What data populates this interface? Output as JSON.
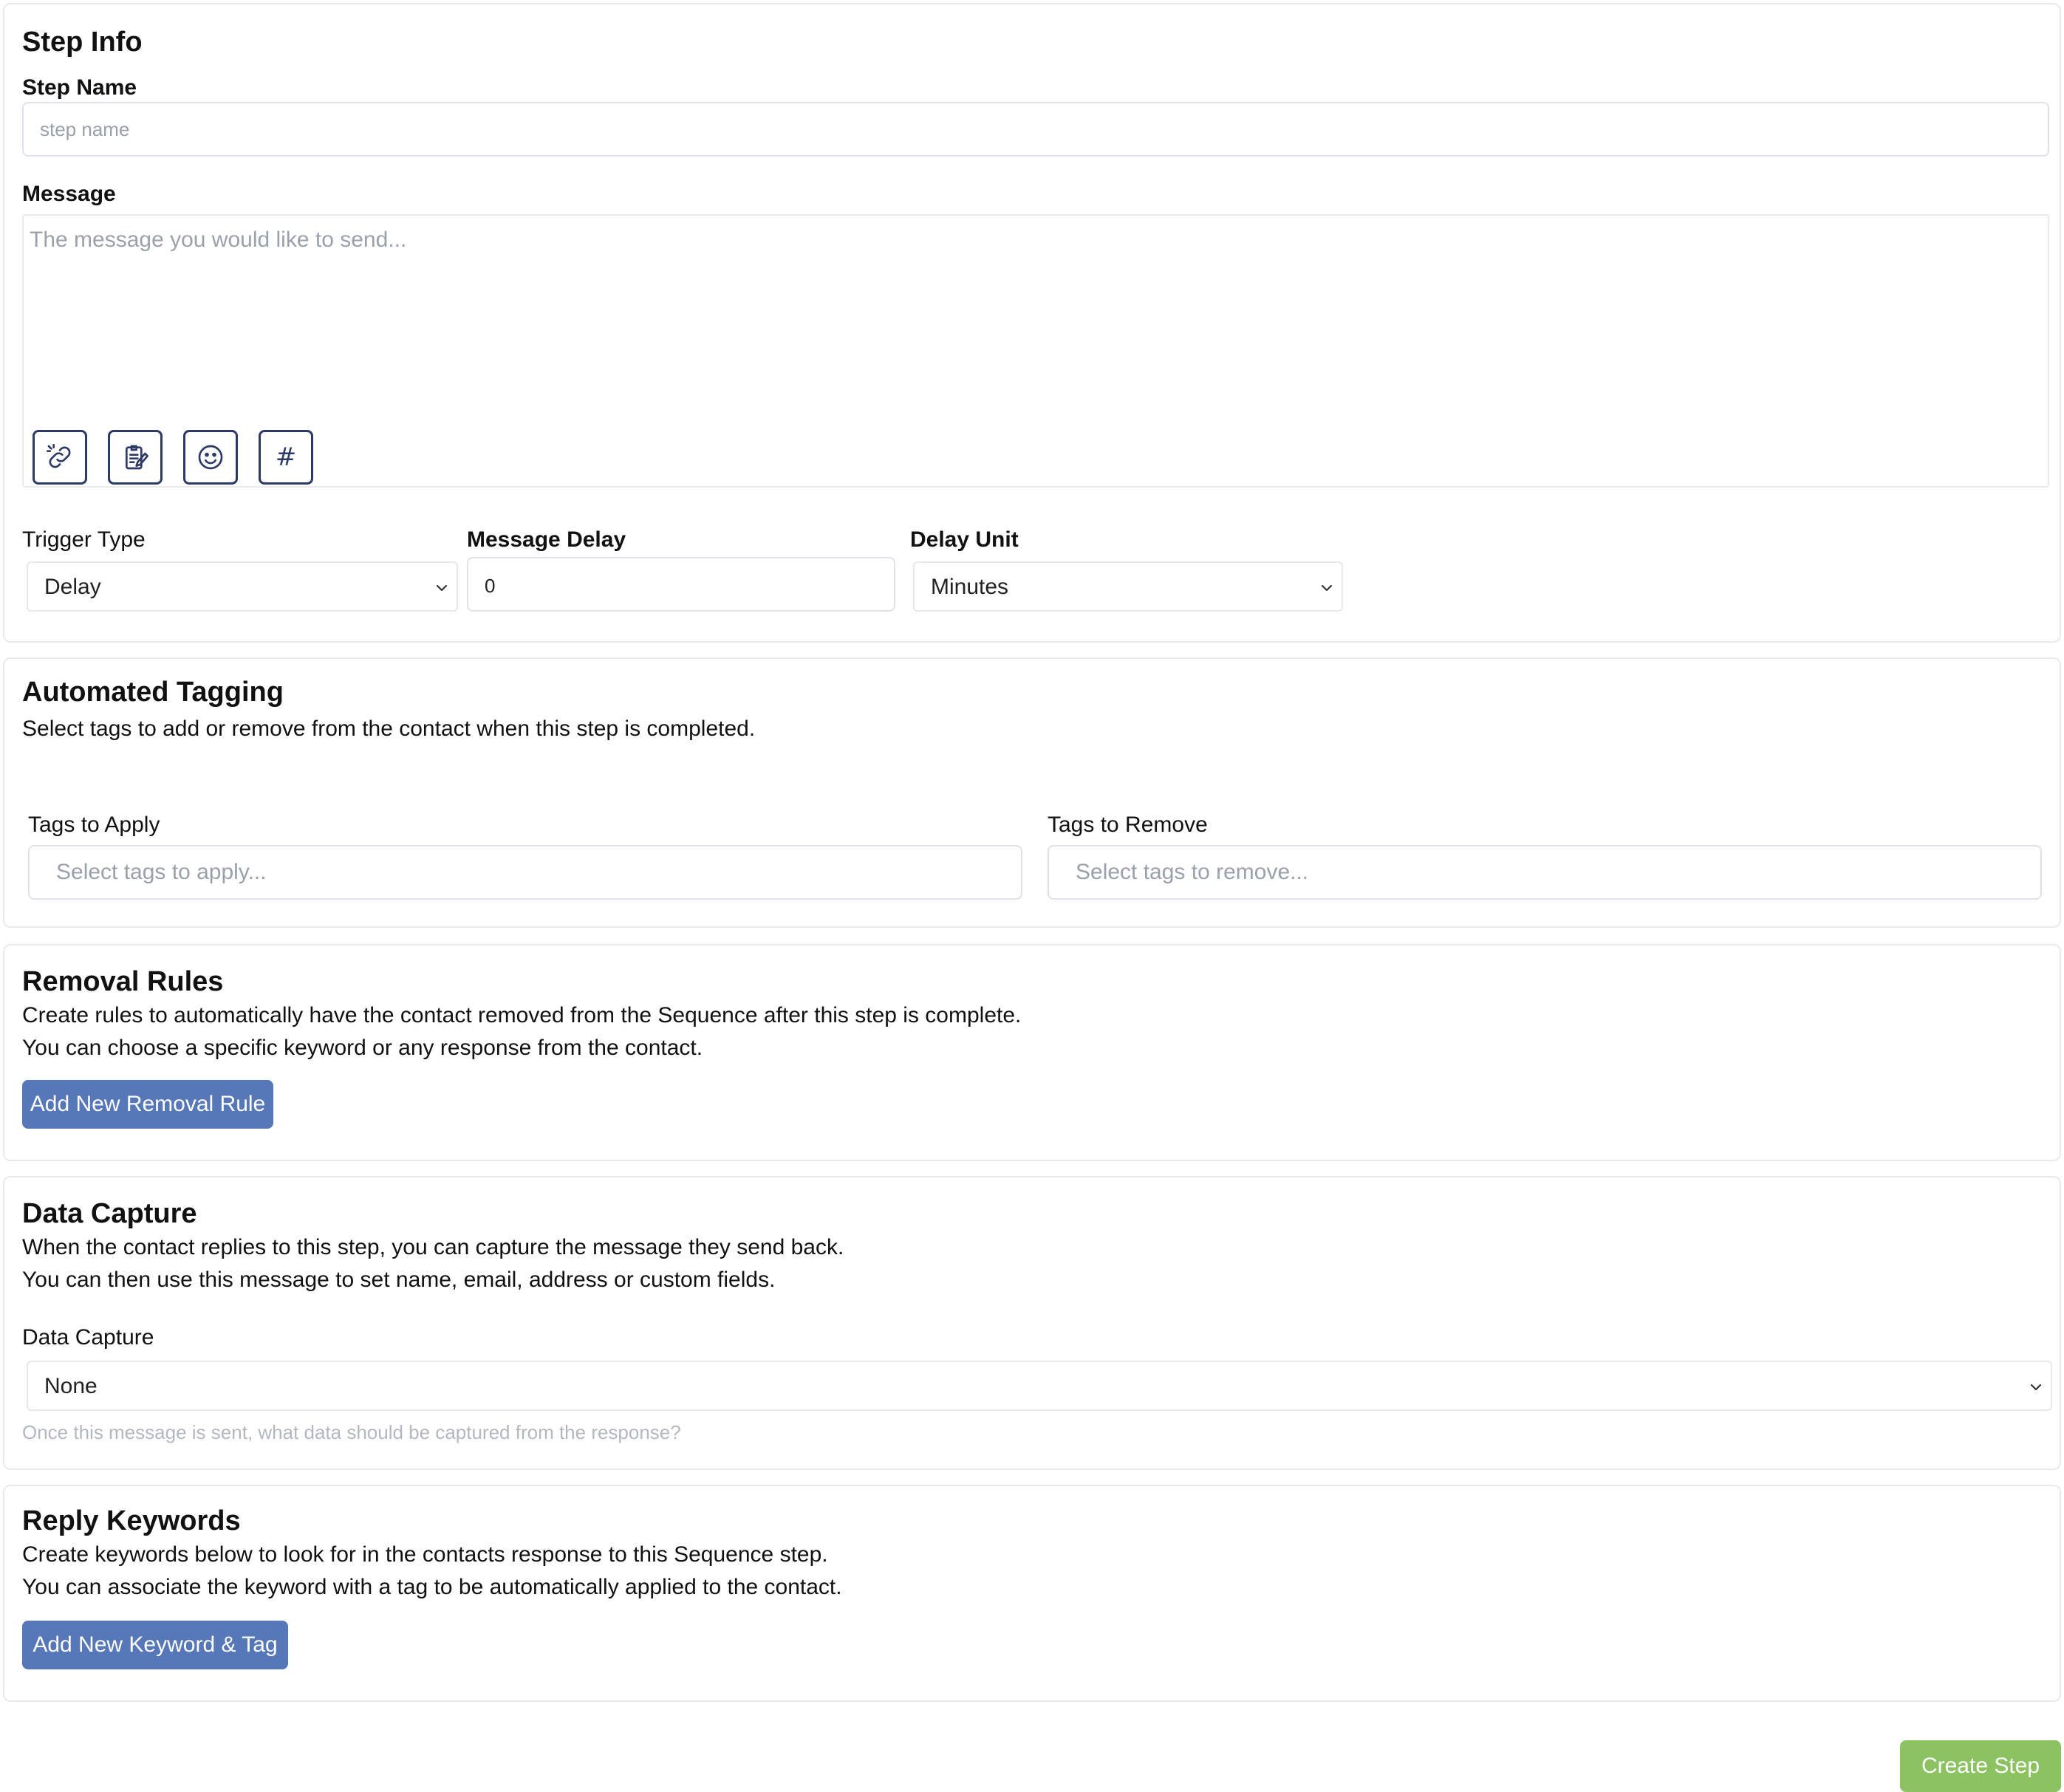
{
  "step_info": {
    "title": "Step Info",
    "step_name_label": "Step Name",
    "step_name_placeholder": "step name",
    "message_label": "Message",
    "message_placeholder": "The message you would like to send...",
    "toolbar_icons": [
      "link-icon",
      "clipboard-icon",
      "emoji-icon",
      "hashtag-icon"
    ],
    "hashtag_glyph": "#",
    "trigger_type_label": "Trigger Type",
    "trigger_type_value": "Delay",
    "message_delay_label": "Message Delay",
    "message_delay_value": "0",
    "delay_unit_label": "Delay Unit",
    "delay_unit_value": "Minutes"
  },
  "automated_tagging": {
    "title": "Automated Tagging",
    "description": "Select tags to add or remove from the contact when this step is completed.",
    "apply_label": "Tags to Apply",
    "apply_placeholder": "Select tags to apply...",
    "remove_label": "Tags to Remove",
    "remove_placeholder": "Select tags to remove..."
  },
  "removal_rules": {
    "title": "Removal Rules",
    "line1": "Create rules to automatically have the contact removed from the Sequence after this step is complete.",
    "line2": "You can choose a specific keyword or any response from the contact.",
    "button": "Add New Removal Rule"
  },
  "data_capture": {
    "title": "Data Capture",
    "line1": "When the contact replies to this step, you can capture the message they send back.",
    "line2": "You can then use this message to set name, email, address or custom fields.",
    "field_label": "Data Capture",
    "value": "None",
    "hint": "Once this message is sent, what data should be captured from the response?"
  },
  "reply_keywords": {
    "title": "Reply Keywords",
    "line1": "Create keywords below to look for in the contacts response to this Sequence step.",
    "line2": "You can associate the keyword with a tag to be automatically applied to the contact.",
    "button": "Add New Keyword & Tag"
  },
  "footer": {
    "create_button": "Create Step"
  },
  "colors": {
    "primary_button": "#5677b8",
    "success_button": "#8dc262",
    "icon_stroke": "#2d3a66",
    "border": "#e8eaee",
    "placeholder": "#9aa1ab"
  }
}
